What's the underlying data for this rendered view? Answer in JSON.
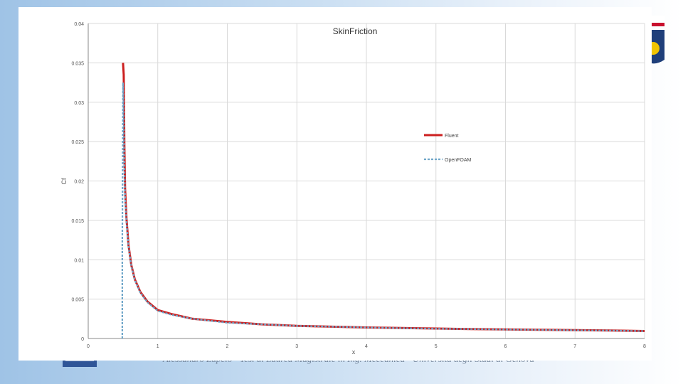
{
  "footer": {
    "text": "Alessandro Zupelo - Tesi di Laurea Magistrale in Ing. Meccanica - Università degli Studi di Genova"
  },
  "colors": {
    "fluent": "#cc1f1f",
    "openfoam": "#6fa6c9",
    "grid": "#d9d9d9",
    "axis": "#888888"
  },
  "chart_data": {
    "type": "line",
    "title": "SkinFriction",
    "xlabel": "x",
    "ylabel": "Cf",
    "xlim": [
      0,
      8
    ],
    "ylim": [
      0,
      0.04
    ],
    "x_ticks": [
      "0",
      "1",
      "2",
      "3",
      "4",
      "5",
      "6",
      "7",
      "8"
    ],
    "y_ticks": [
      "0",
      "0.005",
      "0.01",
      "0.015",
      "0.02",
      "0.025",
      "0.03",
      "0.035",
      "0.04"
    ],
    "grid": true,
    "legend_position": "right",
    "series": [
      {
        "name": "Fluent",
        "style": "solid",
        "x": [
          0.5,
          0.51,
          0.52,
          0.53,
          0.55,
          0.58,
          0.62,
          0.67,
          0.75,
          0.85,
          1.0,
          1.2,
          1.5,
          2.0,
          2.5,
          3.0,
          3.5,
          4.0,
          4.5,
          5.0,
          5.5,
          6.0,
          6.5,
          7.0,
          7.5,
          8.0
        ],
        "y": [
          0.035,
          0.0335,
          0.0245,
          0.019,
          0.0152,
          0.0118,
          0.0093,
          0.0075,
          0.0059,
          0.0047,
          0.0036,
          0.0031,
          0.0025,
          0.0021,
          0.0018,
          0.0016,
          0.0015,
          0.0014,
          0.00133,
          0.00126,
          0.0012,
          0.00115,
          0.00111,
          0.00106,
          0.00102,
          0.00095
        ]
      },
      {
        "name": "OpenFOAM",
        "style": "dashed",
        "x": [
          0.49,
          0.49,
          0.5,
          0.505,
          0.51,
          0.52,
          0.53,
          0.55,
          0.58,
          0.62,
          0.67,
          0.75,
          0.85,
          1.0,
          1.2,
          1.5,
          2.0,
          2.5,
          3.0,
          3.5,
          4.0,
          4.5,
          5.0,
          5.5,
          6.0,
          6.5,
          7.0,
          7.5,
          8.0
        ],
        "y": [
          0.0,
          0.012,
          0.0325,
          0.031,
          0.0275,
          0.0225,
          0.018,
          0.0148,
          0.0116,
          0.0092,
          0.0074,
          0.0058,
          0.0046,
          0.0035,
          0.003,
          0.0025,
          0.002,
          0.0018,
          0.0016,
          0.0015,
          0.0014,
          0.00132,
          0.00125,
          0.00119,
          0.00114,
          0.0011,
          0.00105,
          0.00101,
          0.00094
        ]
      }
    ]
  }
}
